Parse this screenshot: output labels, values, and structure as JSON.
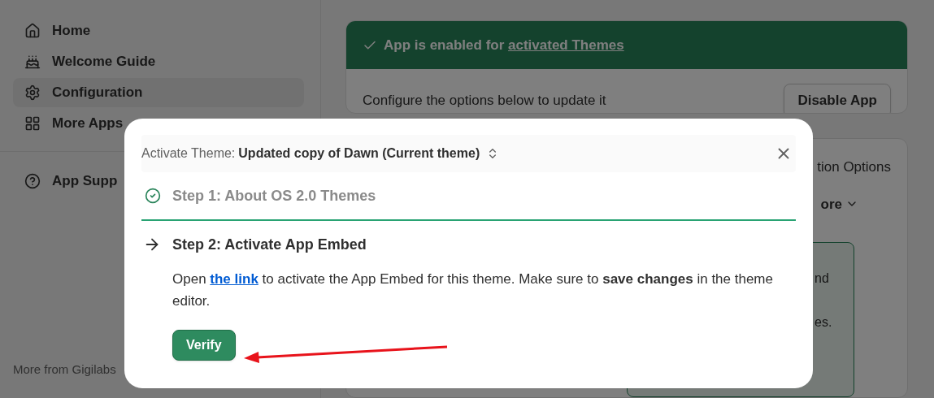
{
  "sidebar": {
    "items": [
      {
        "label": "Home",
        "selected": false
      },
      {
        "label": "Welcome Guide",
        "selected": false
      },
      {
        "label": "Configuration",
        "selected": true
      },
      {
        "label": "More Apps",
        "selected": false
      }
    ],
    "support": "App Supp",
    "footer": "More from Gigilabs"
  },
  "status_banner": {
    "text": "App is enabled for",
    "link": "activated Themes"
  },
  "config": {
    "text": "Configure the options below to update it",
    "button": "Disable App"
  },
  "options_card": {
    "title": "tion Options",
    "more": "ore",
    "fragments": [
      "nd",
      "es."
    ]
  },
  "dialog": {
    "theme_label": "Activate Theme:",
    "theme_value": "Updated copy of Dawn (Current theme)",
    "steps": [
      {
        "title": "Step 1: About OS 2.0 Themes",
        "completed": true,
        "active": false
      },
      {
        "title": "Step 2: Activate App Embed",
        "completed": false,
        "active": true
      }
    ],
    "instruction": {
      "before": "Open",
      "link": "the link",
      "after": "to activate the App Embed for this theme. Make sure to **save changes** in the theme editor."
    },
    "button": "Verify"
  }
}
